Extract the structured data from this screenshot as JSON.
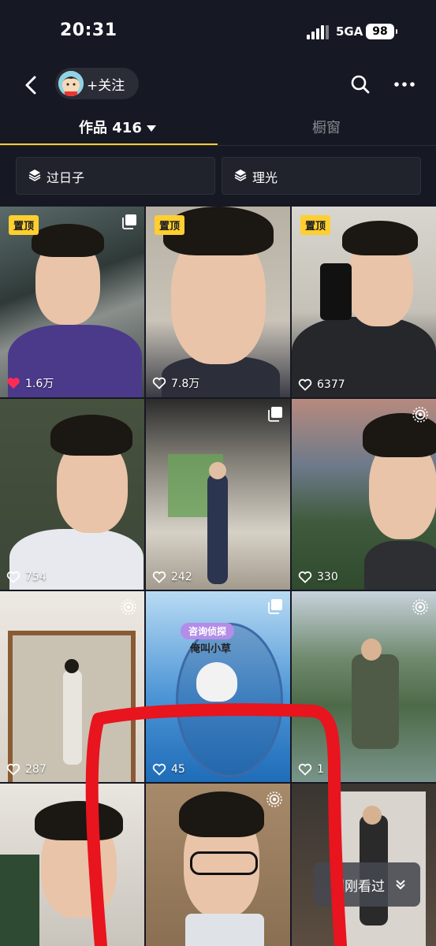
{
  "status_bar": {
    "time": "20:31",
    "network": "5GA",
    "battery": "98"
  },
  "nav": {
    "follow_label": "+关注",
    "back_icon": "chevron-left-icon",
    "search_icon": "search-icon",
    "more_icon": "more-dots-icon"
  },
  "tabs": [
    {
      "label": "作品 416",
      "active": true
    },
    {
      "label": "橱窗",
      "active": false
    }
  ],
  "collections": [
    {
      "label": "过日子",
      "icon": "layers-icon"
    },
    {
      "label": "理光",
      "icon": "layers-icon"
    }
  ],
  "colors": {
    "accent": "#fecf2f",
    "background": "#161823",
    "like_red": "#fe2c55",
    "annotation_red": "#e8141e"
  },
  "grid": [
    {
      "likes": "1.6万",
      "pinned_label": "置顶",
      "liked": true,
      "badge": "multi-image-icon"
    },
    {
      "likes": "7.8万",
      "pinned_label": "置顶",
      "liked": false,
      "badge": ""
    },
    {
      "likes": "6377",
      "pinned_label": "置顶",
      "liked": false,
      "badge": ""
    },
    {
      "likes": "754",
      "pinned_label": "",
      "liked": false,
      "badge": ""
    },
    {
      "likes": "242",
      "pinned_label": "",
      "liked": false,
      "badge": "multi-image-icon"
    },
    {
      "likes": "330",
      "pinned_label": "",
      "liked": false,
      "badge": "live-photo-icon"
    },
    {
      "likes": "287",
      "pinned_label": "",
      "liked": false,
      "badge": "live-photo-icon"
    },
    {
      "likes": "45",
      "pinned_label": "",
      "liked": false,
      "badge": "multi-image-icon",
      "overlay_title": "咨询侦探",
      "overlay_name": "俺叫小草"
    },
    {
      "likes": "1",
      "pinned_label": "",
      "liked": false,
      "badge": "live-photo-icon"
    },
    {
      "likes": "",
      "pinned_label": "",
      "liked": false,
      "badge": ""
    },
    {
      "likes": "",
      "pinned_label": "",
      "liked": false,
      "badge": "live-photo-icon"
    },
    {
      "likes": "",
      "pinned_label": "",
      "liked": false,
      "badge": ""
    }
  ],
  "just_seen": {
    "label": "刚刚看过"
  }
}
